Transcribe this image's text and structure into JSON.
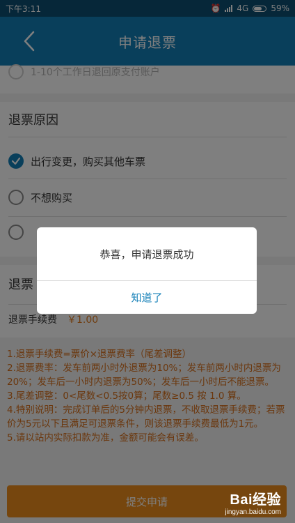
{
  "status": {
    "time": "下午3:11",
    "network": "4G",
    "battery": "59%"
  },
  "header": {
    "title": "申请退票"
  },
  "refund_method": {
    "hint": "1-10个工作日退回原支付账户"
  },
  "reason": {
    "title": "退票原因",
    "options": [
      {
        "label": "出行变更，购买其他车票",
        "checked": true
      },
      {
        "label": "不想购买",
        "checked": false
      }
    ]
  },
  "fee": {
    "section_title": "退票",
    "label": "退票手续费",
    "amount": "￥1.00"
  },
  "notes": [
    "1.退票手续费=票价×退票费率（尾差调整）",
    "2.退票费率：发车前两小时外退票为10%；发车前两小时内退票为20%；发车后一小时内退票为50%；发车后一小时后不能退票。",
    "3.尾差调整：0<尾数<0.5按0算；尾数≥0.5 按 1.0 算。",
    "4.特别说明：完成订单后的5分钟内退票，不收取退票手续费；若票价为5元以下且满足可退票条件，则该退票手续费最低为1元。",
    "5.请以站内实际扣款为准，金额可能会有误差。"
  ],
  "submit": {
    "label": "提交申请"
  },
  "dialog": {
    "message": "恭喜，申请退票成功",
    "ok": "知道了"
  },
  "watermark": {
    "brand": "Bai经验",
    "url": "jingyan.baidu.com"
  },
  "colors": {
    "primary": "#137fb7",
    "statusbar": "#0c4f73",
    "accent": "#ec8c1c",
    "note": "#d76f1a"
  }
}
